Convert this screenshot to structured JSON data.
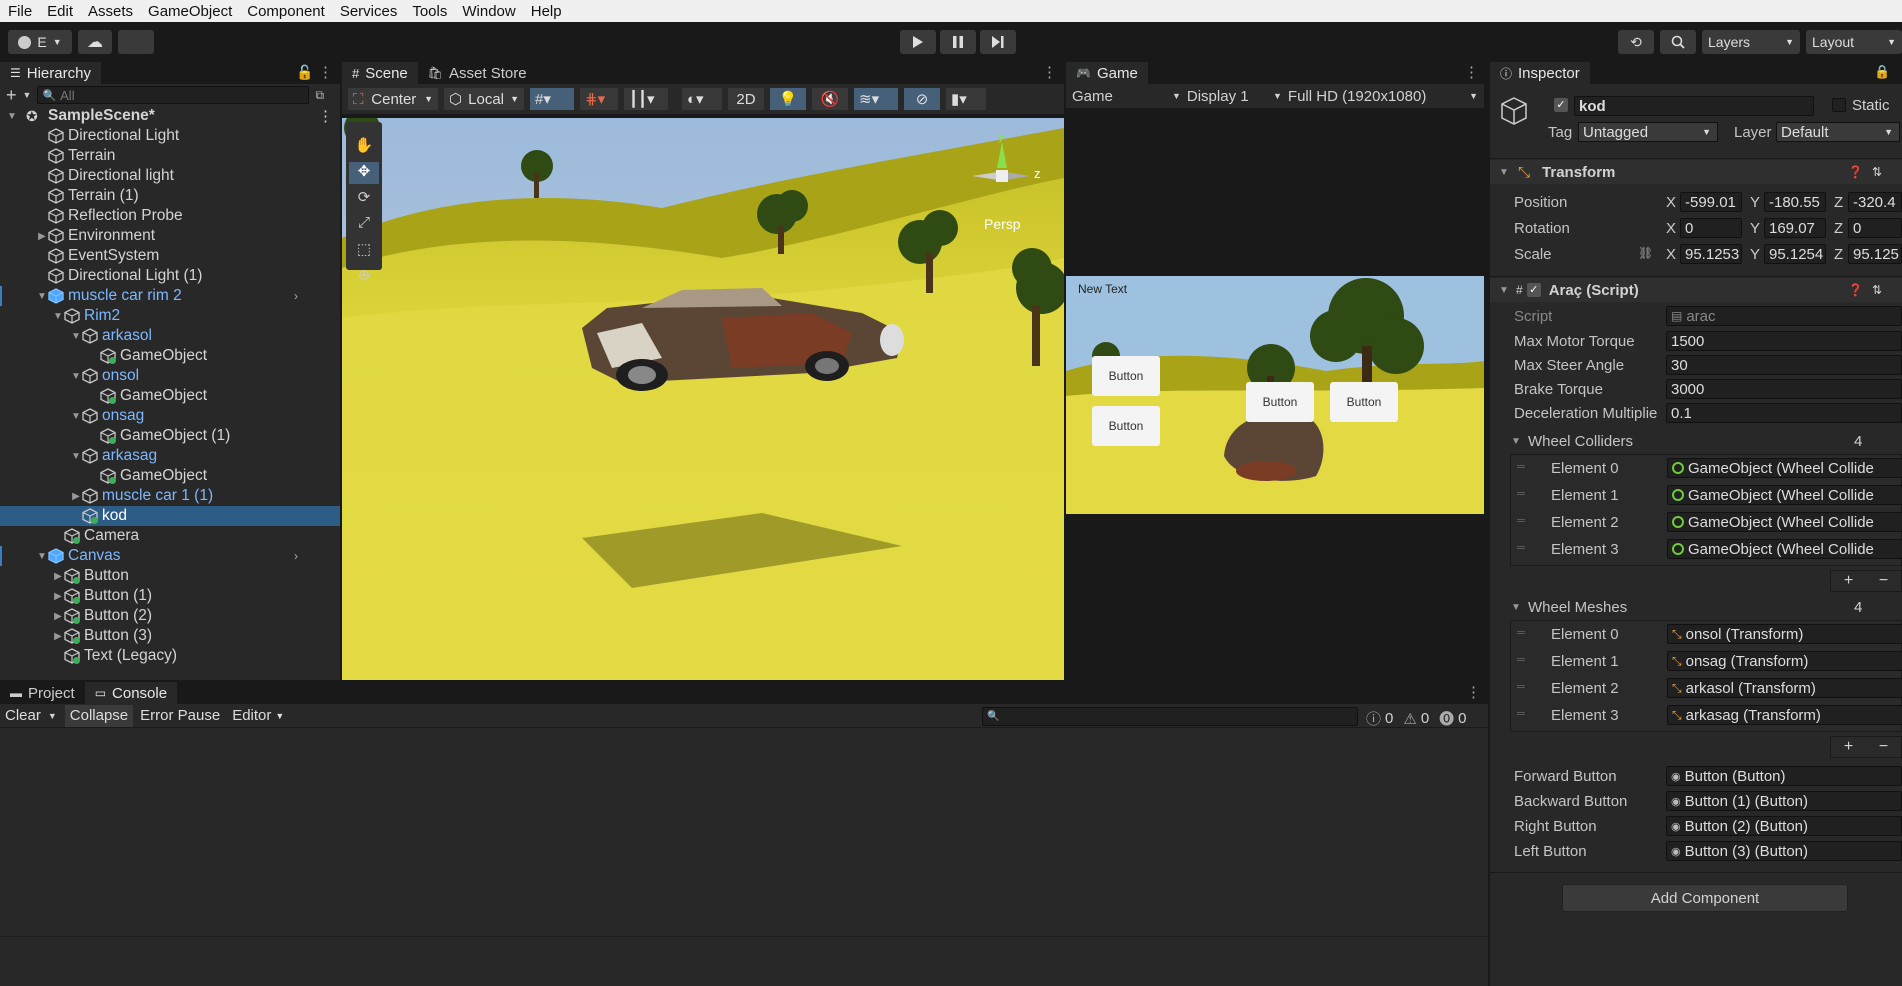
{
  "menu": [
    "File",
    "Edit",
    "Assets",
    "GameObject",
    "Component",
    "Services",
    "Tools",
    "Window",
    "Help"
  ],
  "toolbar": {
    "account": "E",
    "layers": "Layers",
    "layout": "Layout"
  },
  "hierarchy": {
    "tab": "Hierarchy",
    "search_placeholder": "All",
    "scene": "SampleScene*",
    "items": [
      {
        "label": "Directional Light",
        "depth": 1,
        "blue": false,
        "exp": "",
        "icon": "cube"
      },
      {
        "label": "Terrain",
        "depth": 1,
        "blue": false,
        "exp": "",
        "icon": "cube"
      },
      {
        "label": "Directional light",
        "depth": 1,
        "blue": false,
        "exp": "",
        "icon": "cube"
      },
      {
        "label": "Terrain (1)",
        "depth": 1,
        "blue": false,
        "exp": "",
        "icon": "cube"
      },
      {
        "label": "Reflection Probe",
        "depth": 1,
        "blue": false,
        "exp": "",
        "icon": "cube"
      },
      {
        "label": "Environment",
        "depth": 1,
        "blue": false,
        "exp": "closed",
        "icon": "cube"
      },
      {
        "label": "EventSystem",
        "depth": 1,
        "blue": false,
        "exp": "",
        "icon": "cube"
      },
      {
        "label": "Directional Light (1)",
        "depth": 1,
        "blue": false,
        "exp": "",
        "icon": "cube"
      },
      {
        "label": "muscle car rim 2",
        "depth": 1,
        "blue": true,
        "exp": "open",
        "icon": "prefab",
        "arrow": true
      },
      {
        "label": "Rim2",
        "depth": 2,
        "blue": true,
        "exp": "open",
        "icon": "cube"
      },
      {
        "label": "arkasol",
        "depth": 3,
        "blue": true,
        "exp": "open",
        "icon": "cube"
      },
      {
        "label": "GameObject",
        "depth": 4,
        "blue": false,
        "exp": "",
        "icon": "cubegreen"
      },
      {
        "label": "onsol",
        "depth": 3,
        "blue": true,
        "exp": "open",
        "icon": "cube"
      },
      {
        "label": "GameObject",
        "depth": 4,
        "blue": false,
        "exp": "",
        "icon": "cubegreen"
      },
      {
        "label": "onsag",
        "depth": 3,
        "blue": true,
        "exp": "open",
        "icon": "cube"
      },
      {
        "label": "GameObject (1)",
        "depth": 4,
        "blue": false,
        "exp": "",
        "icon": "cubegreen"
      },
      {
        "label": "arkasag",
        "depth": 3,
        "blue": true,
        "exp": "open",
        "icon": "cube"
      },
      {
        "label": "GameObject",
        "depth": 4,
        "blue": false,
        "exp": "",
        "icon": "cubegreen"
      },
      {
        "label": "muscle car 1 (1)",
        "depth": 3,
        "blue": true,
        "exp": "closed",
        "icon": "cube"
      },
      {
        "label": "kod",
        "depth": 3,
        "blue": false,
        "exp": "",
        "icon": "cubegreen",
        "sel": true
      },
      {
        "label": "Camera",
        "depth": 2,
        "blue": false,
        "exp": "",
        "icon": "cubegreen"
      },
      {
        "label": "Canvas",
        "depth": 1,
        "blue": true,
        "exp": "open",
        "icon": "prefab",
        "arrow": true
      },
      {
        "label": "Button",
        "depth": 2,
        "blue": false,
        "exp": "closed",
        "icon": "cubegreen"
      },
      {
        "label": "Button (1)",
        "depth": 2,
        "blue": false,
        "exp": "closed",
        "icon": "cubegreen"
      },
      {
        "label": "Button (2)",
        "depth": 2,
        "blue": false,
        "exp": "closed",
        "icon": "cubegreen"
      },
      {
        "label": "Button (3)",
        "depth": 2,
        "blue": false,
        "exp": "closed",
        "icon": "cubegreen"
      },
      {
        "label": "Text (Legacy)",
        "depth": 2,
        "blue": false,
        "exp": "",
        "icon": "cubegreen"
      }
    ]
  },
  "scene": {
    "tab": "Scene",
    "asset_store_tab": "Asset Store",
    "pivot": "Center",
    "space": "Local",
    "mode2d": "2D",
    "persp": "Persp",
    "gizmo_y": "y",
    "gizmo_z": "z"
  },
  "game": {
    "tab": "Game",
    "mode": "Game",
    "display": "Display 1",
    "resolution": "Full HD (1920x1080)",
    "new_text": "New Text",
    "buttons": [
      "Button",
      "Button",
      "Button",
      "Button"
    ]
  },
  "inspector": {
    "tab": "Inspector",
    "name": "kod",
    "static": "Static",
    "tag_label": "Tag",
    "tag": "Untagged",
    "layer_label": "Layer",
    "layer": "Default",
    "transform": {
      "title": "Transform",
      "rows": [
        {
          "label": "Position",
          "x": "-599.01",
          "y": "-180.55",
          "z": "-320.4"
        },
        {
          "label": "Rotation",
          "x": "0",
          "y": "169.07",
          "z": "0"
        },
        {
          "label": "Scale",
          "x": "95.1253",
          "y": "95.1254",
          "z": "95.125"
        }
      ]
    },
    "script": {
      "title": "Araç (Script)",
      "script_label": "Script",
      "script_value": "arac",
      "fields": [
        {
          "label": "Max Motor Torque",
          "value": "1500"
        },
        {
          "label": "Max Steer Angle",
          "value": "30"
        },
        {
          "label": "Brake Torque",
          "value": "3000"
        },
        {
          "label": "Deceleration Multiplie",
          "value": "0.1"
        }
      ],
      "wheel_colliders": {
        "label": "Wheel Colliders",
        "count": "4",
        "elements": [
          {
            "label": "Element 0",
            "value": "GameObject (Wheel Collide"
          },
          {
            "label": "Element 1",
            "value": "GameObject (Wheel Collide"
          },
          {
            "label": "Element 2",
            "value": "GameObject (Wheel Collide"
          },
          {
            "label": "Element 3",
            "value": "GameObject (Wheel Collide"
          }
        ]
      },
      "wheel_meshes": {
        "label": "Wheel Meshes",
        "count": "4",
        "elements": [
          {
            "label": "Element 0",
            "value": "onsol (Transform)"
          },
          {
            "label": "Element 1",
            "value": "onsag (Transform)"
          },
          {
            "label": "Element 2",
            "value": "arkasol (Transform)"
          },
          {
            "label": "Element 3",
            "value": "arkasag (Transform)"
          }
        ]
      },
      "buttons": [
        {
          "label": "Forward Button",
          "value": "Button (Button)"
        },
        {
          "label": "Backward Button",
          "value": "Button (1) (Button)"
        },
        {
          "label": "Right Button",
          "value": "Button (2) (Button)"
        },
        {
          "label": "Left Button",
          "value": "Button (3) (Button)"
        }
      ]
    },
    "add_component": "Add Component"
  },
  "console": {
    "project_tab": "Project",
    "console_tab": "Console",
    "clear": "Clear",
    "collapse": "Collapse",
    "error_pause": "Error Pause",
    "editor": "Editor",
    "counts": [
      "0",
      "0",
      "0"
    ]
  },
  "colors": {
    "accent": "#2c5d87",
    "prefab_blue": "#7cb8ff",
    "panel": "#282828",
    "terrain": "#d8d034",
    "sky": "#9cbadb"
  }
}
